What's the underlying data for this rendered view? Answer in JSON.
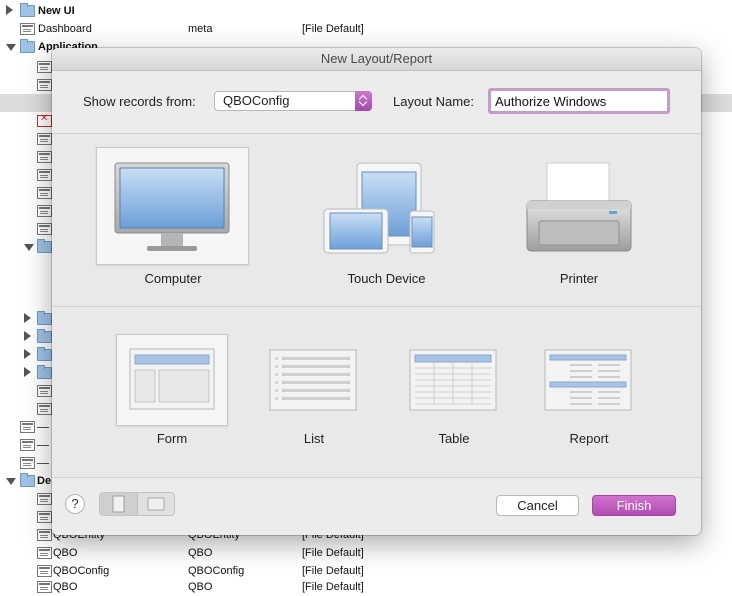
{
  "background": {
    "rows": [
      {
        "name": "New UI",
        "table": "",
        "menu": "",
        "bold": true,
        "icon": "folder",
        "tri": "right",
        "indent": 0
      },
      {
        "name": "Dashboard",
        "table": "meta",
        "menu": "[File Default]",
        "bold": false,
        "icon": "layout",
        "tri": "",
        "indent": 0
      },
      {
        "name": "Application",
        "table": "",
        "menu": "",
        "bold": true,
        "icon": "folder",
        "tri": "down",
        "indent": 0
      },
      {
        "name": "QBOEntity",
        "table": "QBOEntity",
        "menu": "[File Default]",
        "bold": false,
        "icon": "layout",
        "tri": "",
        "indent": 1
      },
      {
        "name": "QBO",
        "table": "QBO",
        "menu": "[File Default]",
        "bold": false,
        "icon": "layout",
        "tri": "",
        "indent": 1
      },
      {
        "name": "QBOConfig",
        "table": "QBOConfig",
        "menu": "[File Default]",
        "bold": false,
        "icon": "layout",
        "tri": "",
        "indent": 1
      },
      {
        "name": "QBO",
        "table": "QBO",
        "menu": "[File Default]",
        "bold": false,
        "icon": "layout",
        "tri": "",
        "indent": 1
      }
    ],
    "dev_folder_label": "De"
  },
  "dialog": {
    "title": "New Layout/Report",
    "show_records_label": "Show records from:",
    "show_records_value": "QBOConfig",
    "layout_name_label": "Layout Name:",
    "layout_name_value": "Authorize Windows",
    "devices": [
      {
        "label": "Computer",
        "selected": true
      },
      {
        "label": "Touch Device",
        "selected": false
      },
      {
        "label": "Printer",
        "selected": false
      }
    ],
    "styles": [
      {
        "label": "Form",
        "selected": true
      },
      {
        "label": "List",
        "selected": false
      },
      {
        "label": "Table",
        "selected": false
      },
      {
        "label": "Report",
        "selected": false
      }
    ],
    "help_label": "?",
    "cancel_label": "Cancel",
    "finish_label": "Finish"
  },
  "colors": {
    "accent": "#b24db2",
    "selection_row": "#dcdcdc"
  }
}
